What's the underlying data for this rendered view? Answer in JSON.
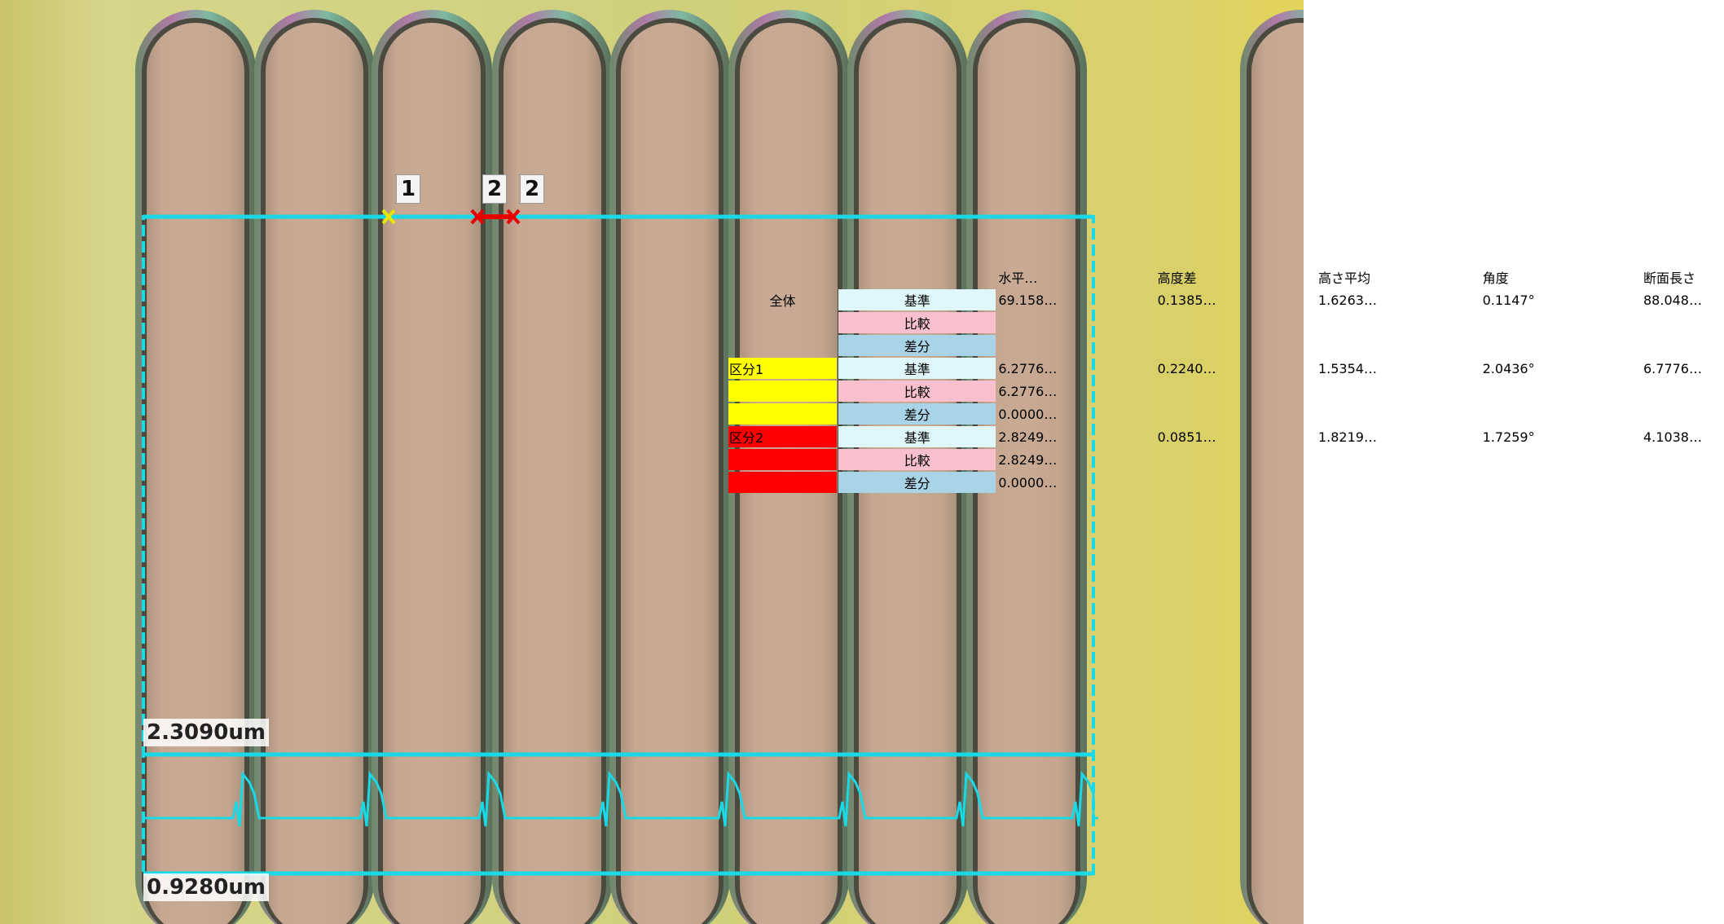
{
  "markers": {
    "m1": "1",
    "m2a": "2",
    "m2b": "2"
  },
  "profile": {
    "top_value": "2.3090um",
    "bottom_value": "0.9280um"
  },
  "colors": {
    "profile_line": "#19d9e6",
    "marker1": "#e6e600",
    "marker2": "#e60000",
    "section1": "#ffff00",
    "section2": "#ff0000",
    "header_bg": "#a8d2ec"
  },
  "table": {
    "headers": [
      "",
      "",
      "水平…",
      "高度差",
      "高さ平均",
      "角度",
      "断面長さ"
    ],
    "rows": [
      {
        "section": "全体",
        "section_color": "none",
        "type": "基準",
        "type_class": "kijun",
        "values": [
          "69.158…",
          "0.1385…",
          "1.6263…",
          "0.1147°",
          "88.048…"
        ]
      },
      {
        "section": "",
        "section_color": "none",
        "type": "比較",
        "type_class": "hikaku",
        "values": [
          "",
          "",
          "",
          "",
          ""
        ]
      },
      {
        "section": "",
        "section_color": "none",
        "type": "差分",
        "type_class": "sabun",
        "values": [
          "",
          "",
          "",
          "",
          ""
        ]
      },
      {
        "section": "区分1",
        "section_color": "yellow",
        "type": "基準",
        "type_class": "kijun",
        "values": [
          "6.2776…",
          "0.2240…",
          "1.5354…",
          "2.0436°",
          "6.7776…"
        ]
      },
      {
        "section": "",
        "section_color": "yellow",
        "type": "比較",
        "type_class": "hikaku",
        "values": [
          "6.2776…",
          "",
          "",
          "",
          ""
        ]
      },
      {
        "section": "",
        "section_color": "yellow",
        "type": "差分",
        "type_class": "sabun",
        "values": [
          "0.0000…",
          "",
          "",
          "",
          ""
        ]
      },
      {
        "section": "区分2",
        "section_color": "red",
        "type": "基準",
        "type_class": "kijun",
        "values": [
          "2.8249…",
          "0.0851…",
          "1.8219…",
          "1.7259°",
          "4.1038…"
        ]
      },
      {
        "section": "",
        "section_color": "red",
        "type": "比較",
        "type_class": "hikaku",
        "values": [
          "2.8249…",
          "",
          "",
          "",
          ""
        ]
      },
      {
        "section": "",
        "section_color": "red",
        "type": "差分",
        "type_class": "sabun",
        "values": [
          "0.0000…",
          "",
          "",
          "",
          ""
        ]
      }
    ]
  }
}
